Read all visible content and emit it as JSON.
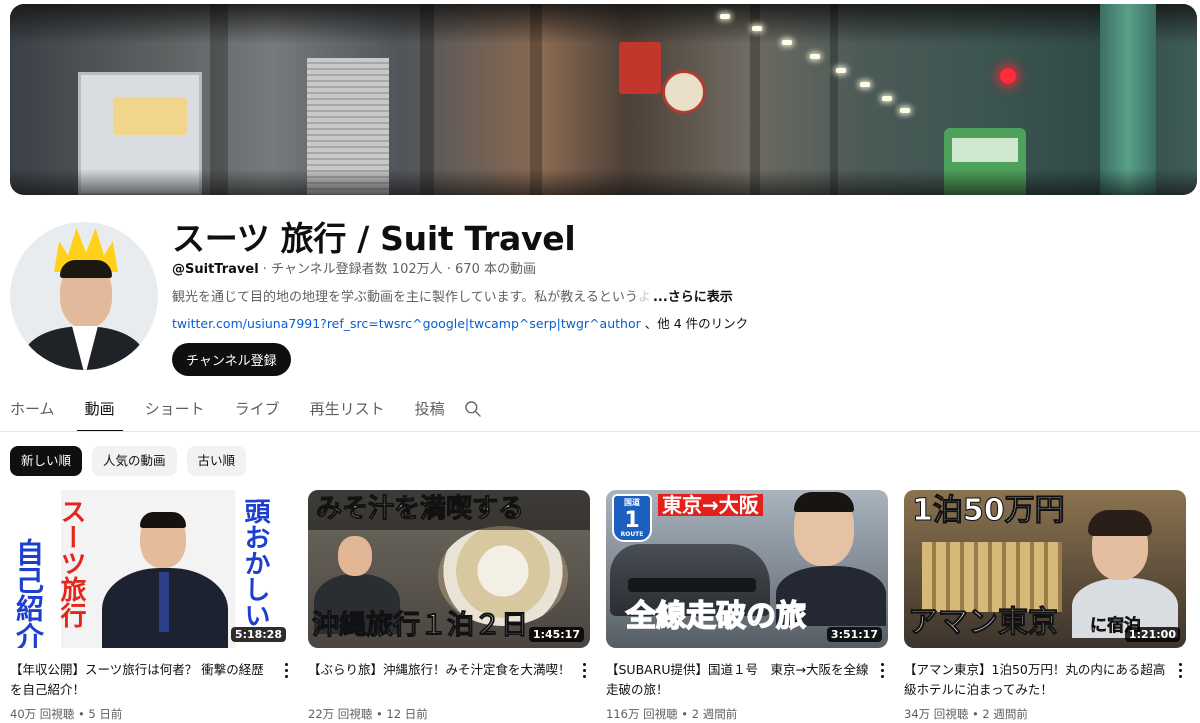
{
  "channel": {
    "name": "スーツ 旅行 / Suit Travel",
    "handle": "@SuitTravel",
    "stats": " · チャンネル登録者数 102万人 · 670 本の動画",
    "description": "観光を通じて目的地の地理を学ぶ動画を主に製作しています。私が教えるという",
    "description_fade": "よ",
    "more_label": "...さらに表示",
    "link": "twitter.com/usiuna7991?ref_src=twsrc^google|twcamp^serp|twgr^author",
    "link_others": "、他 4 件のリンク",
    "subscribe_label": "チャンネル登録"
  },
  "tabs": [
    {
      "label": "ホーム",
      "active": false
    },
    {
      "label": "動画",
      "active": true
    },
    {
      "label": "ショート",
      "active": false
    },
    {
      "label": "ライブ",
      "active": false
    },
    {
      "label": "再生リスト",
      "active": false
    },
    {
      "label": "投稿",
      "active": false
    }
  ],
  "chips": [
    {
      "label": "新しい順",
      "active": true
    },
    {
      "label": "人気の動画",
      "active": false
    },
    {
      "label": "古い順",
      "active": false
    }
  ],
  "videos": [
    {
      "title": "【年収公開】スーツ旅行は何者？ 衝撃の経歴を自己紹介！",
      "views": "40万 回視聴",
      "age": "5 日前",
      "duration": "5:18:28",
      "thumb_text": {
        "a": "自己紹介",
        "b": "スーツ旅行",
        "c": "頭おかしい"
      }
    },
    {
      "title": "【ぶらり旅】沖縄旅行！みそ汁定食を大満喫！",
      "views": "22万 回視聴",
      "age": "12 日前",
      "duration": "1:45:17",
      "thumb_text": {
        "a": "みそ汁を満喫する",
        "b": "沖縄旅行１泊２日"
      }
    },
    {
      "title": "【SUBARU提供】国道１号　東京→大阪を全線走破の旅！",
      "views": "116万 回視聴",
      "age": "2 週間前",
      "duration": "3:51:17",
      "thumb_text": {
        "route_top": "国道",
        "route_num": "1",
        "route_bottom": "ROUTE",
        "a": "東京→大阪",
        "b": "全線走破の旅"
      }
    },
    {
      "title": "【アマン東京】1泊50万円！丸の内にある超高級ホテルに泊まってみた！",
      "views": "34万 回視聴",
      "age": "2 週間前",
      "duration": "1:21:00",
      "thumb_text": {
        "a": "1泊50万円",
        "b": "アマン東京",
        "c": "に宿泊"
      }
    }
  ],
  "icons": {
    "search_tab": "search-icon",
    "more": "more-vertical-icon"
  }
}
